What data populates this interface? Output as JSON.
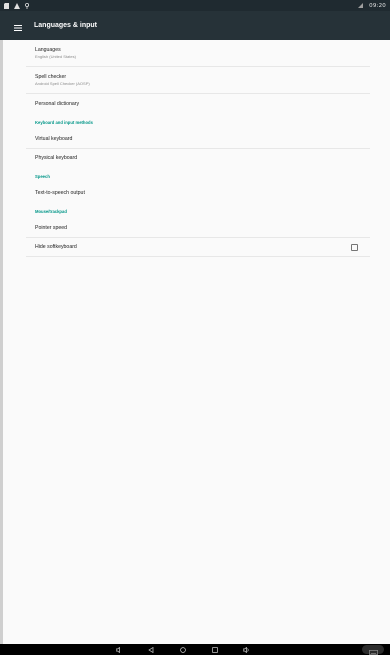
{
  "status_bar": {
    "time": "09:20",
    "icons": [
      "sd-card-icon",
      "warning-icon",
      "location-icon",
      "signal-icon"
    ]
  },
  "toolbar": {
    "title": "Languages & input",
    "menu_icon": "menu-icon"
  },
  "items": {
    "languages": {
      "title": "Languages",
      "summary": "English (United States)"
    },
    "spell_checker": {
      "title": "Spell checker",
      "summary": "Android Spell Checker (AOSP)"
    },
    "personal_dictionary": {
      "title": "Personal dictionary"
    },
    "category_keyboard": "Keyboard and input methods",
    "virtual_keyboard": {
      "title": "Virtual keyboard"
    },
    "physical_keyboard": {
      "title": "Physical keyboard"
    },
    "category_speech": "Speech",
    "tts_output": {
      "title": "Text-to-speech output"
    },
    "category_mouse": "Mouse/trackpad",
    "pointer_speed": {
      "title": "Pointer speed"
    },
    "hide_softkeyboard": {
      "title": "Hide softkeyboard",
      "checked": false
    }
  },
  "nav_bar": {
    "icons": [
      "volume-down-icon",
      "back-icon",
      "home-icon",
      "recents-icon",
      "volume-up-icon",
      "keyboard-icon"
    ]
  },
  "colors": {
    "toolbar": "#263238",
    "status_bar": "#1f2a30",
    "accent": "#009688",
    "background": "#fafafa"
  }
}
